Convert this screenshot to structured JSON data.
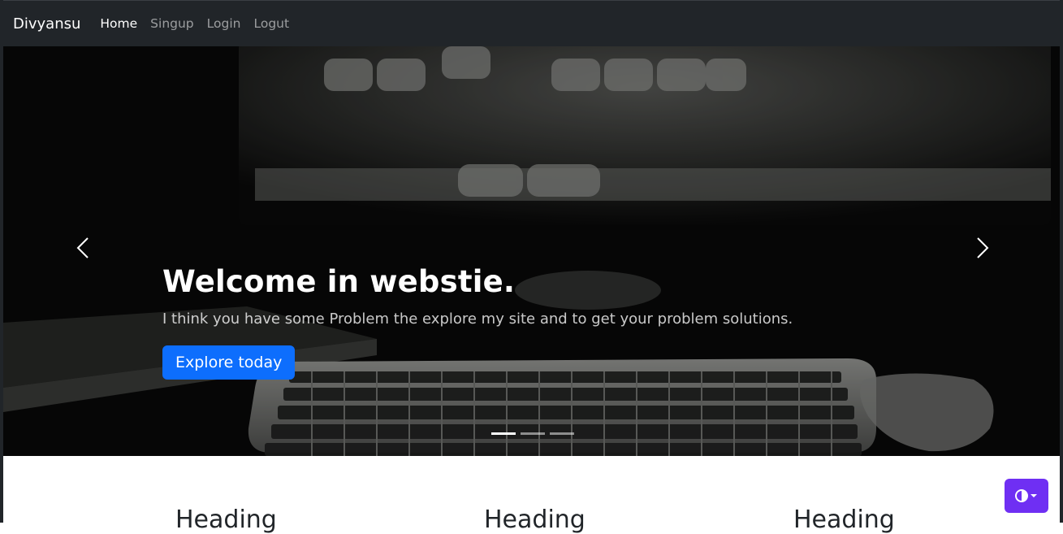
{
  "navbar": {
    "brand": "Divyansu",
    "links": [
      {
        "label": "Home",
        "active": true
      },
      {
        "label": "Singup",
        "active": false
      },
      {
        "label": "Login",
        "active": false
      },
      {
        "label": "Logut",
        "active": false
      }
    ]
  },
  "carousel": {
    "title": "Welcome in webstie.",
    "text": "I think you have some Problem the explore my site and to get your problem solutions.",
    "button_label": "Explore today",
    "slide_count": 3,
    "active_slide": 1,
    "prev_icon": "chevron-left-icon",
    "next_icon": "chevron-right-icon"
  },
  "content": {
    "headings": [
      "Heading",
      "Heading",
      "Heading"
    ]
  },
  "theme_toggle": {
    "icon": "contrast-icon",
    "color": "#6f2ff3"
  },
  "colors": {
    "navbar": "#212529",
    "primary": "#0d6efd",
    "accent": "#6f2ff3"
  }
}
